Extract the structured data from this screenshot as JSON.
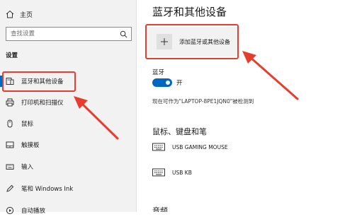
{
  "sidebar": {
    "home": "主页",
    "search_placeholder": "查找设置",
    "section": "设置",
    "items": [
      {
        "label": "蓝牙和其他设备",
        "icon": "bluetooth-devices-icon",
        "active": true
      },
      {
        "label": "打印机和扫描仪",
        "icon": "printer-icon"
      },
      {
        "label": "鼠标",
        "icon": "mouse-icon"
      },
      {
        "label": "触摸板",
        "icon": "touchpad-icon"
      },
      {
        "label": "输入",
        "icon": "keyboard-icon"
      },
      {
        "label": "笔和 Windows Ink",
        "icon": "pen-icon"
      },
      {
        "label": "自动播放",
        "icon": "autoplay-icon"
      }
    ]
  },
  "main": {
    "title": "蓝牙和其他设备",
    "add_device_label": "添加蓝牙或其他设备",
    "bluetooth_label": "蓝牙",
    "bluetooth_state": "开",
    "discoverable_text": "现在可作为\"LAPTOP-8PE1JQN0\"被检测到",
    "mouse_section_title": "鼠标、键盘和笔",
    "devices": [
      {
        "name": "USB GAMING MOUSE",
        "icon": "keyboard-icon"
      },
      {
        "name": "USB KB",
        "icon": "keyboard-icon"
      }
    ],
    "audio_section_title": "音频"
  },
  "colors": {
    "accent": "#0067c0",
    "callout": "#e53d2e",
    "sidebar_bg": "#f2f2f2"
  }
}
